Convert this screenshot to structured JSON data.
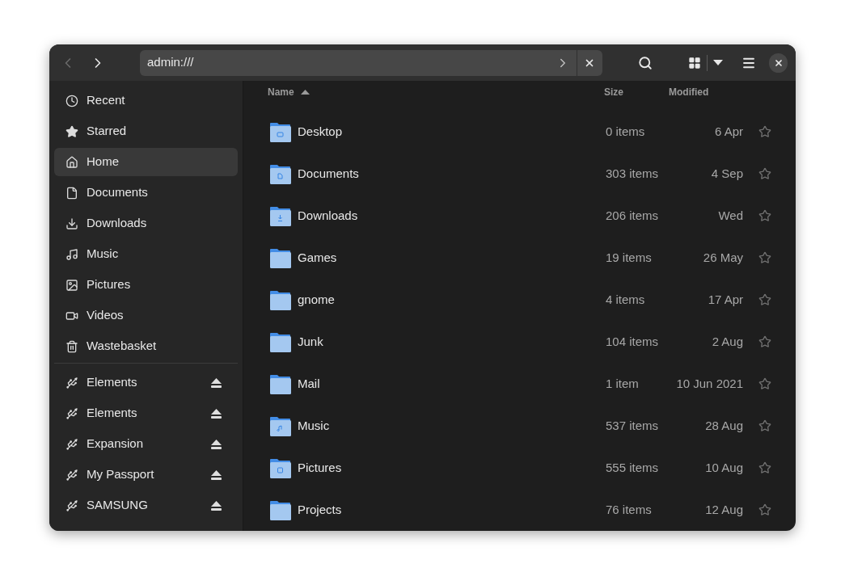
{
  "header": {
    "back_enabled": false,
    "forward_enabled": true,
    "location": "admin:///"
  },
  "sidebar": {
    "places": [
      {
        "label": "Recent",
        "kind": "recent",
        "selected": false
      },
      {
        "label": "Starred",
        "kind": "starred",
        "selected": false
      },
      {
        "label": "Home",
        "kind": "home",
        "selected": true
      },
      {
        "label": "Documents",
        "kind": "documents",
        "selected": false
      },
      {
        "label": "Downloads",
        "kind": "downloads",
        "selected": false
      },
      {
        "label": "Music",
        "kind": "music",
        "selected": false
      },
      {
        "label": "Pictures",
        "kind": "pictures",
        "selected": false
      },
      {
        "label": "Videos",
        "kind": "videos",
        "selected": false
      },
      {
        "label": "Wastebasket",
        "kind": "trash",
        "selected": false
      }
    ],
    "drives": [
      {
        "label": "Elements"
      },
      {
        "label": "Elements"
      },
      {
        "label": "Expansion"
      },
      {
        "label": "My Passport"
      },
      {
        "label": "SAMSUNG"
      }
    ]
  },
  "table": {
    "columns": [
      {
        "label": "Name",
        "sorted": true
      },
      {
        "label": "Size",
        "sorted": false
      },
      {
        "label": "Modified",
        "sorted": false
      }
    ],
    "rows": [
      {
        "name": "Desktop",
        "kind": "desktop",
        "size": "0 items",
        "modified": "6 Apr",
        "starred": false
      },
      {
        "name": "Documents",
        "kind": "document",
        "size": "303 items",
        "modified": "4 Sep",
        "starred": false
      },
      {
        "name": "Downloads",
        "kind": "download",
        "size": "206 items",
        "modified": "Wed",
        "starred": false
      },
      {
        "name": "Games",
        "kind": "plain",
        "size": "19 items",
        "modified": "26 May",
        "starred": false
      },
      {
        "name": "gnome",
        "kind": "plain",
        "size": "4 items",
        "modified": "17 Apr",
        "starred": false
      },
      {
        "name": "Junk",
        "kind": "plain",
        "size": "104 items",
        "modified": "2 Aug",
        "starred": false
      },
      {
        "name": "Mail",
        "kind": "plain",
        "size": "1 item",
        "modified": "10 Jun 2021",
        "starred": false
      },
      {
        "name": "Music",
        "kind": "music",
        "size": "537 items",
        "modified": "28 Aug",
        "starred": false
      },
      {
        "name": "Pictures",
        "kind": "picture",
        "size": "555 items",
        "modified": "10 Aug",
        "starred": false
      },
      {
        "name": "Projects",
        "kind": "plain",
        "size": "76 items",
        "modified": "12 Aug",
        "starred": false
      }
    ]
  }
}
